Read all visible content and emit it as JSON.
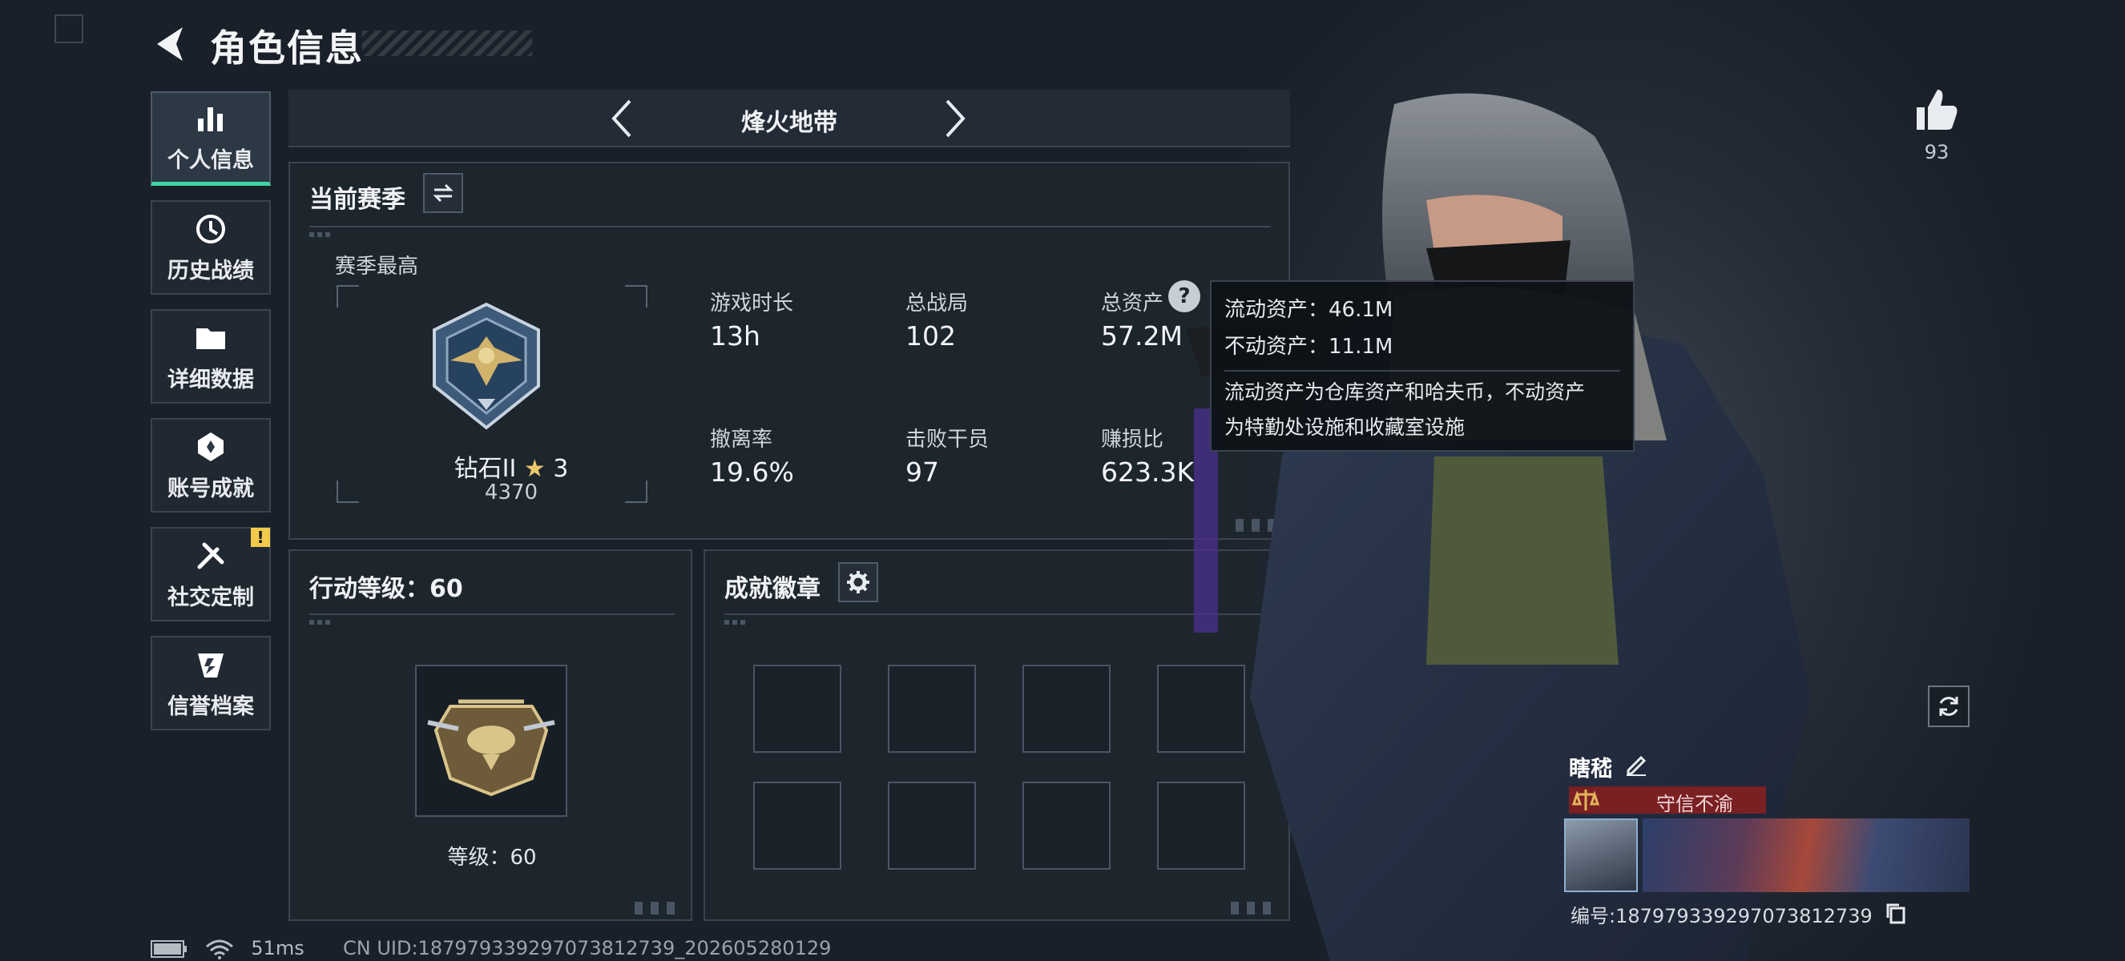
{
  "header": {
    "title": "角色信息"
  },
  "sidebar": {
    "items": [
      {
        "label": "个人信息",
        "icon": "bar-chart-icon",
        "active": true
      },
      {
        "label": "历史战绩",
        "icon": "history-clock-icon"
      },
      {
        "label": "详细数据",
        "icon": "folder-icon"
      },
      {
        "label": "账号成就",
        "icon": "achievement-icon"
      },
      {
        "label": "社交定制",
        "icon": "tools-icon",
        "badge": "!"
      },
      {
        "label": "信誉档案",
        "icon": "reputation-icon"
      }
    ]
  },
  "mode": {
    "label": "烽火地带"
  },
  "season": {
    "title": "当前赛季",
    "best_label": "赛季最高",
    "rank_name": "钻石II",
    "rank_stars": "3",
    "rank_score": "4370",
    "stats": [
      {
        "label": "游戏时长",
        "value": "13h"
      },
      {
        "label": "总战局",
        "value": "102"
      },
      {
        "label": "总资产",
        "value": "57.2M"
      },
      {
        "label": "撤离率",
        "value": "19.6%"
      },
      {
        "label": "击败干员",
        "value": "97"
      },
      {
        "label": "赚损比",
        "value": "623.3K"
      }
    ]
  },
  "tooltip": {
    "liquid": "流动资产：46.1M",
    "fixed": "不动资产：11.1M",
    "desc_line1": "流动资产为仓库资产和哈夫币，不动资产",
    "desc_line2": "为特勤处设施和收藏室设施"
  },
  "action_level": {
    "title": "行动等级：60",
    "level_text": "等级：60"
  },
  "achievements": {
    "title": "成就徽章",
    "slots": 8
  },
  "likes": {
    "count": "93"
  },
  "player": {
    "name": "瞎嵇",
    "credit": "守信不渝",
    "id_text": "编号:187979339297073812739"
  },
  "status": {
    "ping": "51ms",
    "uid": "CN UID:187979339297073812739_202605280129"
  },
  "colors": {
    "accent": "#3ed7a7",
    "credit": "#7a1f22",
    "badge": "#f2c94c"
  }
}
